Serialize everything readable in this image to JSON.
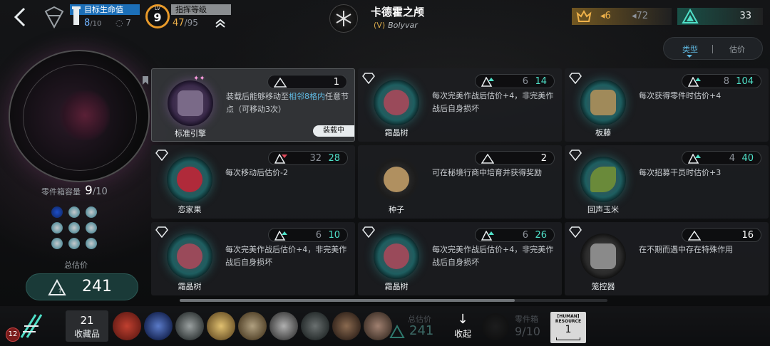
{
  "top_bar": {
    "target_hp": {
      "title": "目标生命值",
      "current": "8",
      "max": "/10",
      "shield": "7"
    },
    "commander": {
      "lv_label": "LV",
      "level": "9",
      "title": "指挥等级",
      "exp": "47",
      "exp_max": "/95"
    },
    "character": {
      "name": "卡德霍之颅",
      "tag": "(V)",
      "subtitle": "Bolyvar"
    },
    "currency_gold": {
      "value": "6",
      "value2": "72"
    },
    "currency_teal": {
      "value": "33"
    }
  },
  "sort_toggle": {
    "option_1": "类型",
    "option_2": "估价"
  },
  "left_panel": {
    "capacity_label": "零件箱容量",
    "capacity_current": "9",
    "capacity_max": "/10",
    "slots_filled": 9,
    "slots_total": 10,
    "total_label": "总估价",
    "total_value": "241"
  },
  "cards": [
    {
      "name": "标准引擎",
      "desc_pre": "装载后能够移动至",
      "desc_hl": "相邻8格内",
      "desc_post": "任意节点（可移动3次）",
      "price_plain": "1",
      "tag": "装载中",
      "equipped": true
    },
    {
      "name": "霜晶树",
      "desc_pre": "每次完美作战后估价+4，非完美作战后自身损坏",
      "price_old": "6",
      "price_new": "14"
    },
    {
      "name": "板藤",
      "desc_pre": "每次获得零件时估价+4",
      "price_old": "8",
      "price_new": "104"
    },
    {
      "name": "恋家果",
      "desc_pre": "每次移动后估价-2",
      "price_old": "32",
      "price_new": "28"
    },
    {
      "name": "种子",
      "desc_pre": "可在秘境行商中培育并获得奖励",
      "price_plain": "2"
    },
    {
      "name": "回声玉米",
      "desc_pre": "每次招募干员时估价+3",
      "price_old": "4",
      "price_new": "40"
    },
    {
      "name": "霜晶树",
      "desc_pre": "每次完美作战后估价+4，非完美作战后自身损坏",
      "price_old": "6",
      "price_new": "10"
    },
    {
      "name": "霜晶树",
      "desc_pre": "每次完美作战后估价+4，非完美作战后自身损坏",
      "price_old": "6",
      "price_new": "26"
    },
    {
      "name": "笼控器",
      "desc_pre": "在不期而遇中存在特殊作用",
      "price_plain": "16"
    }
  ],
  "bottom_bar": {
    "badge": "12",
    "collection_count": "21",
    "collection_label": "收藏品",
    "total_label": "总估价",
    "total_value": "241",
    "collapse_arrow": "↓",
    "collapse_label": "收起",
    "capacity_label": "零件箱",
    "capacity_value": "9/10",
    "human_box_label": "[HUMAN] RESOURCE",
    "human_box_value": "1"
  },
  "colors": {
    "accent_teal": "#4fe0c8",
    "accent_blue": "#5fb8e0",
    "gold": "#f0b24a",
    "hp_blue": "#1c6fb8"
  }
}
